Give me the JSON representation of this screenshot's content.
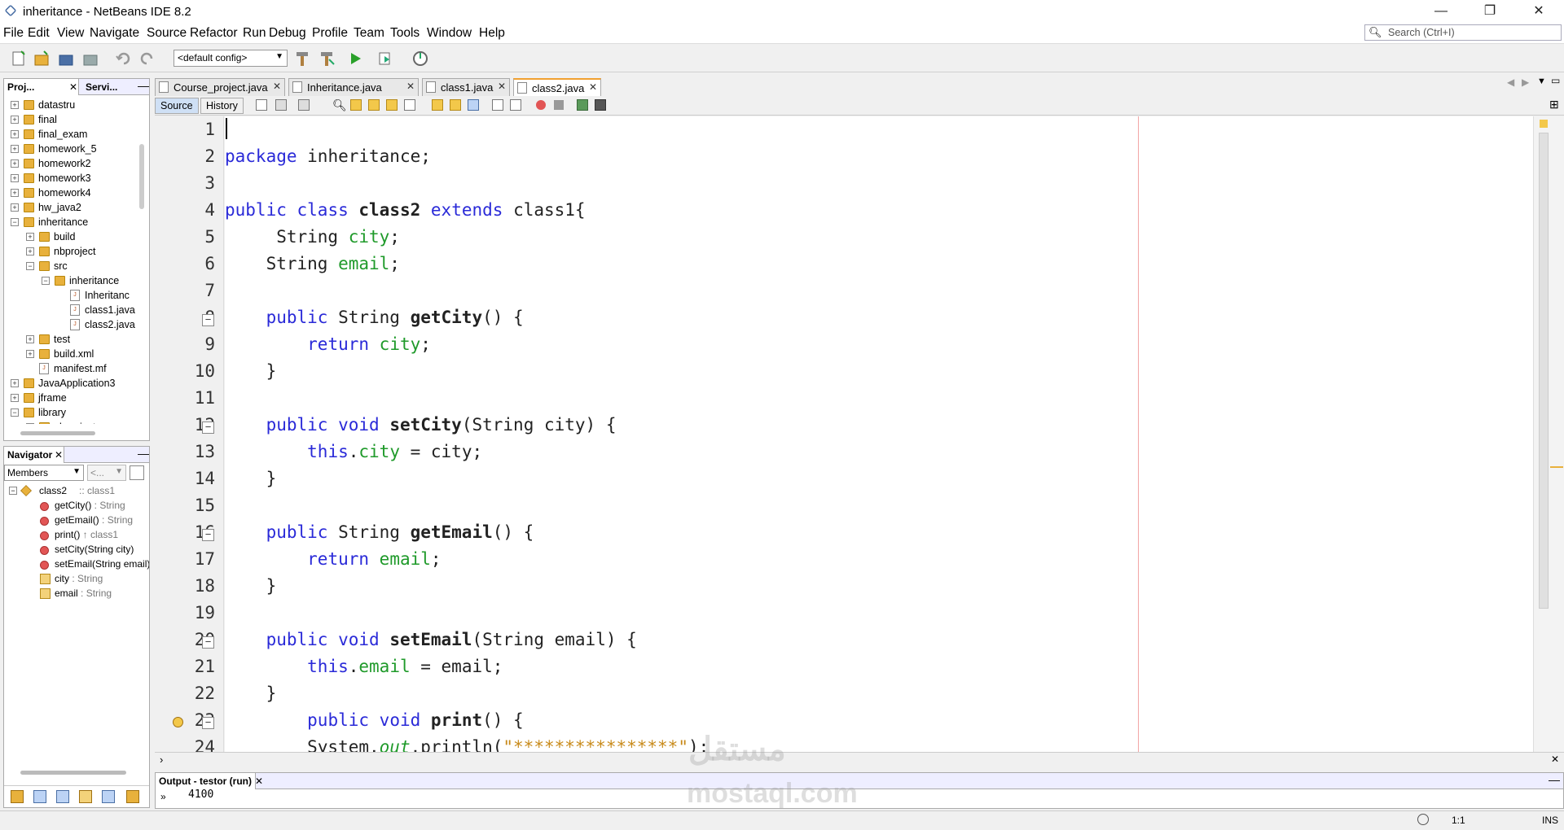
{
  "window": {
    "title": "inheritance - NetBeans IDE 8.2",
    "controls": [
      "—",
      "❐",
      "✕"
    ]
  },
  "menu": [
    "File",
    "Edit",
    "View",
    "Navigate",
    "Source",
    "Refactor",
    "Run",
    "Debug",
    "Profile",
    "Team",
    "Tools",
    "Window",
    "Help"
  ],
  "search": {
    "placeholder": "Search (Ctrl+I)"
  },
  "toolbar": {
    "config": "<default config>"
  },
  "projects": {
    "tabs": [
      "Proj...",
      "Servi..."
    ],
    "tree": [
      {
        "label": "datastru",
        "depth": 0,
        "type": "project",
        "exp": "+"
      },
      {
        "label": "final",
        "depth": 0,
        "type": "project",
        "exp": "+"
      },
      {
        "label": "final_exam",
        "depth": 0,
        "type": "project",
        "exp": "+"
      },
      {
        "label": "homework_5",
        "depth": 0,
        "type": "project",
        "exp": "+"
      },
      {
        "label": "homework2",
        "depth": 0,
        "type": "project",
        "exp": "+"
      },
      {
        "label": "homework3",
        "depth": 0,
        "type": "project",
        "exp": "+"
      },
      {
        "label": "homework4",
        "depth": 0,
        "type": "project",
        "exp": "+"
      },
      {
        "label": "hw_java2",
        "depth": 0,
        "type": "project",
        "exp": "+"
      },
      {
        "label": "inheritance",
        "depth": 0,
        "type": "project",
        "exp": "−"
      },
      {
        "label": "build",
        "depth": 1,
        "type": "folder",
        "exp": "+"
      },
      {
        "label": "nbproject",
        "depth": 1,
        "type": "folder",
        "exp": "+"
      },
      {
        "label": "src",
        "depth": 1,
        "type": "folder",
        "exp": "−"
      },
      {
        "label": "inheritance",
        "depth": 2,
        "type": "package",
        "exp": "−"
      },
      {
        "label": "Inheritanc",
        "depth": 3,
        "type": "java",
        "exp": ""
      },
      {
        "label": "class1.java",
        "depth": 3,
        "type": "java",
        "exp": ""
      },
      {
        "label": "class2.java",
        "depth": 3,
        "type": "java",
        "exp": ""
      },
      {
        "label": "test",
        "depth": 1,
        "type": "folder",
        "exp": "+"
      },
      {
        "label": "build.xml",
        "depth": 1,
        "type": "folder",
        "exp": "+"
      },
      {
        "label": "manifest.mf",
        "depth": 1,
        "type": "java",
        "exp": ""
      },
      {
        "label": "JavaApplication3",
        "depth": 0,
        "type": "project",
        "exp": "+"
      },
      {
        "label": "jframe",
        "depth": 0,
        "type": "project",
        "exp": "+"
      },
      {
        "label": "library",
        "depth": 0,
        "type": "project",
        "exp": "−"
      },
      {
        "label": "nbproject",
        "depth": 1,
        "type": "folder",
        "exp": "+"
      }
    ]
  },
  "navigator": {
    "title": "Navigator",
    "filter": "Members",
    "filter2": "<...",
    "root": {
      "name": "class2",
      "suffix": " :: class1"
    },
    "members": [
      {
        "name": "getCity()",
        "type": " : String",
        "kind": "method"
      },
      {
        "name": "getEmail()",
        "type": " : String",
        "kind": "method"
      },
      {
        "name": "print()",
        "type": " ↑ class1",
        "kind": "method"
      },
      {
        "name": "setCity(String city)",
        "type": "",
        "kind": "method"
      },
      {
        "name": "setEmail(String email)",
        "type": "",
        "kind": "method"
      },
      {
        "name": "city",
        "type": " : String",
        "kind": "field"
      },
      {
        "name": "email",
        "type": " : String",
        "kind": "field"
      }
    ]
  },
  "editor": {
    "tabs": [
      "Course_project.java",
      "Inheritance.java",
      "class1.java",
      "class2.java"
    ],
    "active_tab": 3,
    "source_label": "Source",
    "history_label": "History",
    "line_numbers": [
      "1",
      "2",
      "3",
      "4",
      "5",
      "6",
      "7",
      "8",
      "9",
      "10",
      "11",
      "12",
      "13",
      "14",
      "15",
      "16",
      "17",
      "18",
      "19",
      "20",
      "21",
      "22",
      "23",
      "24"
    ]
  },
  "output": {
    "title": "Output - testor (run)",
    "line": "4100"
  },
  "status": {
    "position": "1:1",
    "mode": "INS"
  },
  "watermark": {
    "arabic": "مستقل",
    "latin": "mostaql.com"
  }
}
